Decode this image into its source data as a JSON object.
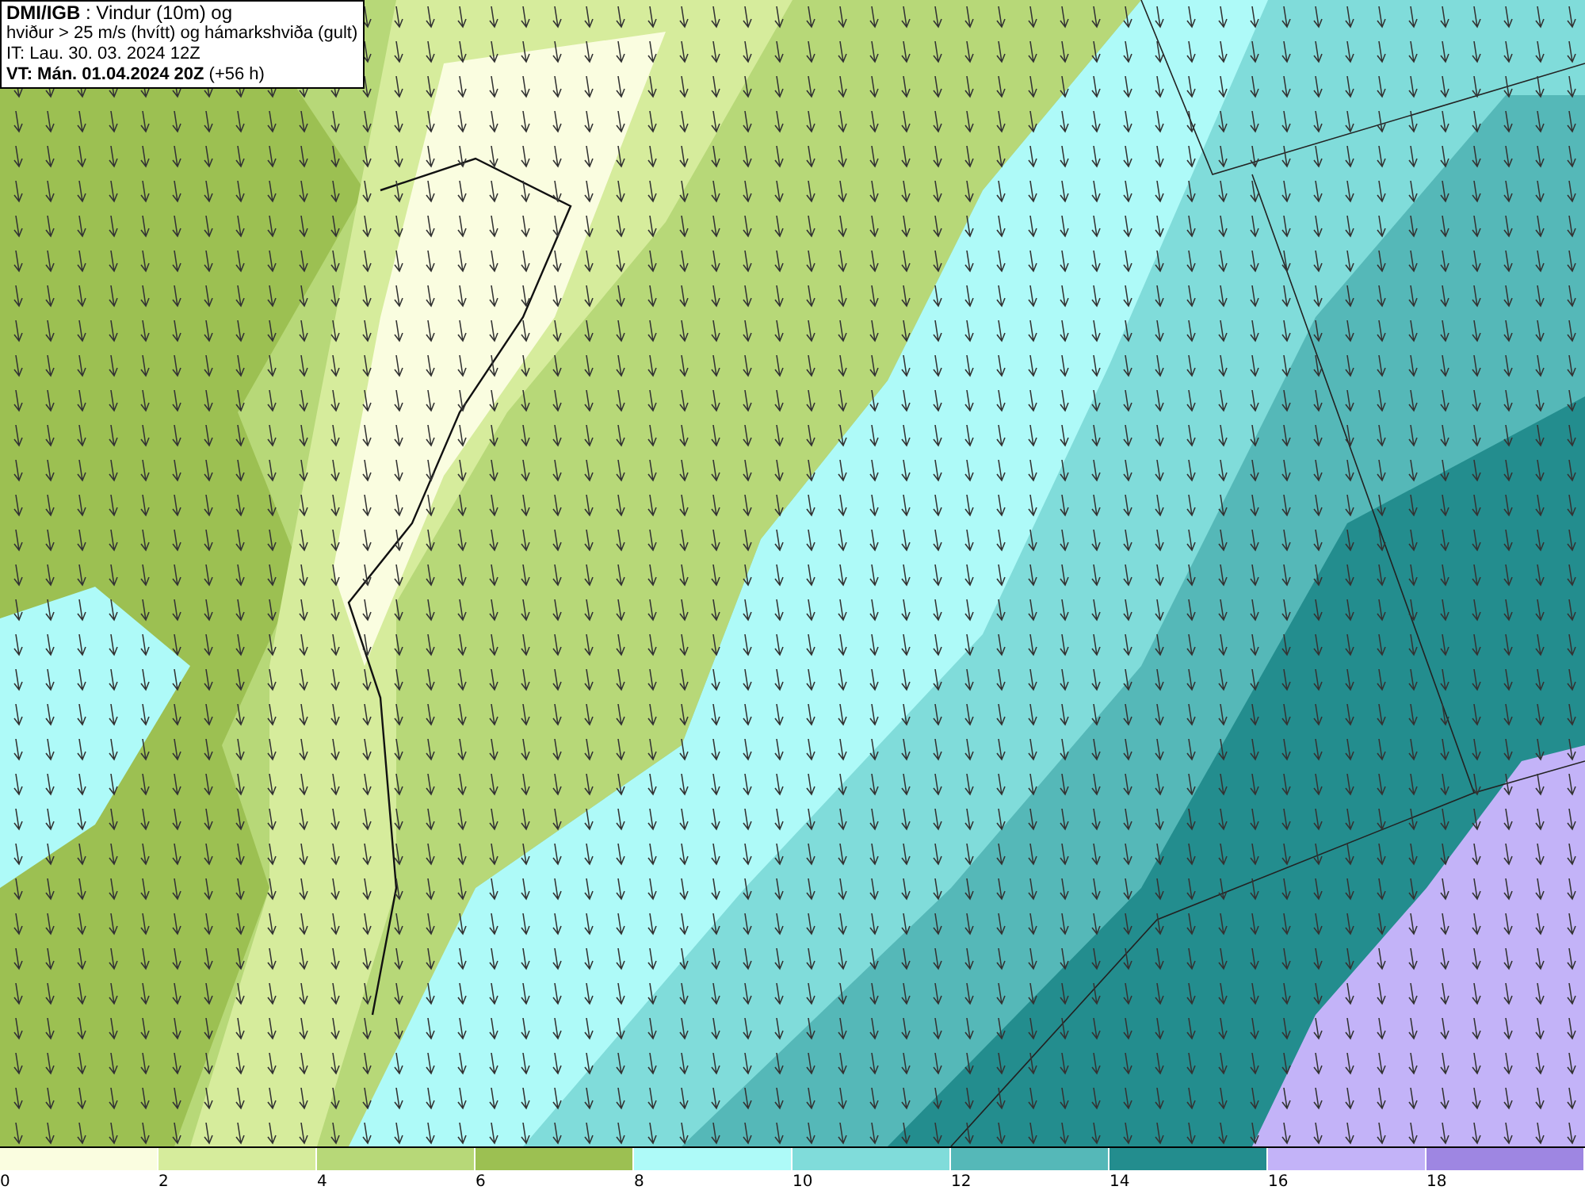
{
  "title_box": {
    "lines": [
      "**DMI/IGB** : Vindur (10m) og",
      "hviður > 25 m/s (hvítt) og hámarkshviða (gult)",
      "IT: Lau. 30. 03. 2024 12Z",
      "**VT: Mán. 01.04.2024 20Z** (+56 h)"
    ]
  },
  "legend": [
    {
      "label": "0",
      "color": "#fafde0"
    },
    {
      "label": "2",
      "color": "#d6ec9c"
    },
    {
      "label": "4",
      "color": "#b7d878"
    },
    {
      "label": "6",
      "color": "#9cc052"
    },
    {
      "label": "8",
      "color": "#aefaf8"
    },
    {
      "label": "10",
      "color": "#80dcda"
    },
    {
      "label": "12",
      "color": "#55b8b8"
    },
    {
      "label": "14",
      "color": "#238d8e"
    },
    {
      "label": "16",
      "color": "#c3b3f8"
    },
    {
      "label": "18",
      "color": "#9e86e2"
    }
  ]
}
